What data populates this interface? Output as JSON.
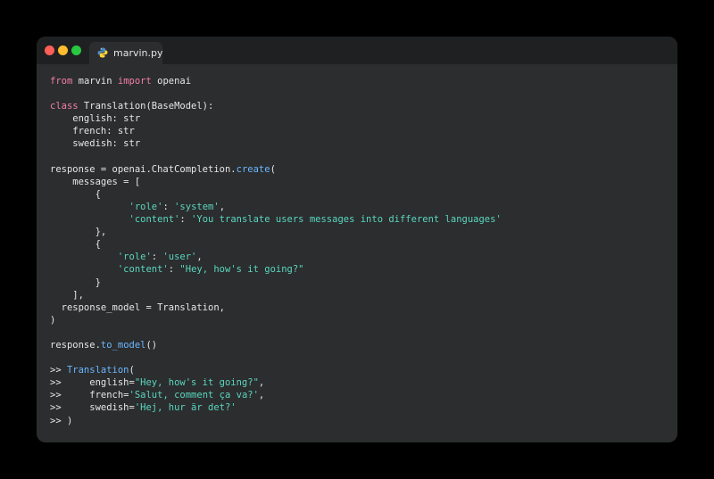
{
  "window": {
    "traffic_lights": [
      "#ff5f57",
      "#febc2e",
      "#28c840"
    ],
    "tab": {
      "label": "marvin.py",
      "icon": "python-icon"
    }
  },
  "colors": {
    "keyword": "#f47fa8",
    "string": "#5bd6c0",
    "function": "#6cb6ff",
    "text": "#e6e6e6",
    "background": "#2b2d2e"
  },
  "code_lines": [
    [
      {
        "t": "from",
        "c": "kw"
      },
      {
        "t": " marvin "
      },
      {
        "t": "import",
        "c": "kw"
      },
      {
        "t": " openai"
      }
    ],
    [],
    [
      {
        "t": "class",
        "c": "kw"
      },
      {
        "t": " Translation(BaseModel):"
      }
    ],
    [
      {
        "t": "    english: str"
      }
    ],
    [
      {
        "t": "    french: str"
      }
    ],
    [
      {
        "t": "    swedish: str"
      }
    ],
    [],
    [
      {
        "t": "response = openai.ChatCompletion."
      },
      {
        "t": "create",
        "c": "fn"
      },
      {
        "t": "("
      }
    ],
    [
      {
        "t": "    messages = ["
      }
    ],
    [
      {
        "t": "        {"
      }
    ],
    [
      {
        "t": "              "
      },
      {
        "t": "'role'",
        "c": "str"
      },
      {
        "t": ": "
      },
      {
        "t": "'system'",
        "c": "str"
      },
      {
        "t": ","
      }
    ],
    [
      {
        "t": "              "
      },
      {
        "t": "'content'",
        "c": "str"
      },
      {
        "t": ": "
      },
      {
        "t": "'You translate users messages into different languages'",
        "c": "str"
      }
    ],
    [
      {
        "t": "        },"
      }
    ],
    [
      {
        "t": "        {"
      }
    ],
    [
      {
        "t": "            "
      },
      {
        "t": "'role'",
        "c": "str"
      },
      {
        "t": ": "
      },
      {
        "t": "'user'",
        "c": "str"
      },
      {
        "t": ","
      }
    ],
    [
      {
        "t": "            "
      },
      {
        "t": "'content'",
        "c": "str"
      },
      {
        "t": ": "
      },
      {
        "t": "\"Hey, how's it going?\"",
        "c": "str"
      }
    ],
    [
      {
        "t": "        }"
      }
    ],
    [
      {
        "t": "    ],"
      }
    ],
    [
      {
        "t": "  response_model = Translation,"
      }
    ],
    [
      {
        "t": ")"
      }
    ],
    [],
    [
      {
        "t": "response."
      },
      {
        "t": "to_model",
        "c": "fn"
      },
      {
        "t": "()"
      }
    ],
    [],
    [
      {
        "t": ">> "
      },
      {
        "t": "Translation",
        "c": "fn"
      },
      {
        "t": "("
      }
    ],
    [
      {
        "t": ">>     english="
      },
      {
        "t": "\"Hey, how's it going?\"",
        "c": "str"
      },
      {
        "t": ","
      }
    ],
    [
      {
        "t": ">>     french="
      },
      {
        "t": "'Salut, comment ça va?'",
        "c": "str"
      },
      {
        "t": ","
      }
    ],
    [
      {
        "t": ">>     swedish="
      },
      {
        "t": "'Hej, hur är det?'",
        "c": "str"
      }
    ],
    [
      {
        "t": ">> )"
      }
    ]
  ]
}
